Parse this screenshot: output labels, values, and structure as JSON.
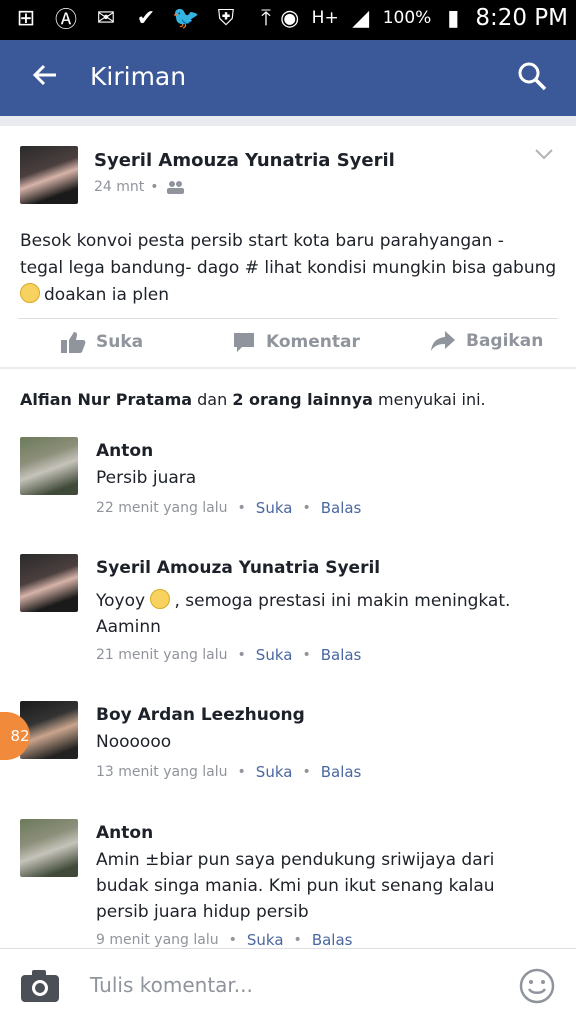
{
  "status_bar": {
    "network": "H+",
    "battery": "100%",
    "time": "8:20 PM"
  },
  "app_bar": {
    "title": "Kiriman"
  },
  "post": {
    "author": "Syeril Amouza Yunatria Syeril",
    "time": "24 mnt",
    "text_line1": "Besok konvoi pesta persib start kota baru parahyangan -",
    "text_line2": "tegal lega bandung- dago # lihat kondisi mungkin bisa gabung",
    "text_line3": "doakan ia plen",
    "actions": {
      "like": "Suka",
      "comment": "Komentar",
      "share": "Bagikan"
    }
  },
  "likes": {
    "name": "Alfian Nur Pratama",
    "connector": " dan ",
    "others": "2 orang lainnya",
    "suffix": " menyukai ini."
  },
  "comments": [
    {
      "author": "Anton",
      "text": "Persib juara",
      "time": "22 menit yang lalu",
      "like": "Suka",
      "reply": "Balas"
    },
    {
      "author": "Syeril Amouza Yunatria Syeril",
      "text_a": "Yoyoy",
      "text_b": ", semoga prestasi ini makin meningkat.",
      "text_c": "Aaminn",
      "time": "21 menit yang lalu",
      "like": "Suka",
      "reply": "Balas"
    },
    {
      "author": "Boy Ardan Leezhuong",
      "text": "Noooooo",
      "time": "13 menit yang lalu",
      "like": "Suka",
      "reply": "Balas"
    },
    {
      "author": "Anton",
      "text_line1": "Amin ±biar pun saya pendukung sriwijaya dari",
      "text_line2": "budak singa mania. Kmi pun ikut senang kalau",
      "text_line3": "persib juara hidup persib",
      "time": "9 menit yang lalu",
      "like": "Suka",
      "reply": "Balas"
    }
  ],
  "badge_count": "82",
  "composer": {
    "placeholder": "Tulis komentar..."
  },
  "colors": {
    "brand": "#3b5998",
    "link": "#4b67a1",
    "muted": "#90949c"
  }
}
